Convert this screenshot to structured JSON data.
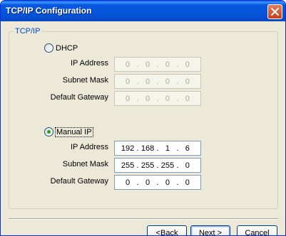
{
  "window": {
    "title": "TCP/IP Configuration"
  },
  "group": {
    "label": "TCP/IP"
  },
  "dhcp": {
    "label": "DHCP",
    "selected": false,
    "fields": [
      {
        "label": "IP Address",
        "segments": [
          "0",
          "0",
          "0",
          "0"
        ]
      },
      {
        "label": "Subnet Mask",
        "segments": [
          "0",
          "0",
          "0",
          "0"
        ]
      },
      {
        "label": "Default Gateway",
        "segments": [
          "0",
          "0",
          "0",
          "0"
        ]
      }
    ]
  },
  "manual": {
    "label": "Manual IP",
    "selected": true,
    "fields": [
      {
        "label": "IP Address",
        "segments": [
          "192",
          "168",
          "1",
          "6"
        ]
      },
      {
        "label": "Subnet Mask",
        "segments": [
          "255",
          "255",
          "255",
          "0"
        ]
      },
      {
        "label": "Default Gateway",
        "segments": [
          "0",
          "0",
          "0",
          "0"
        ]
      }
    ]
  },
  "buttons": {
    "back": {
      "label_pre": "< ",
      "label_accel": "B",
      "label_rest": "ack"
    },
    "next": {
      "label_accel": "N",
      "label_rest": "ext >"
    },
    "cancel": {
      "label": "Cancel"
    }
  },
  "colors": {
    "titlebar": "#0453d7",
    "group_label": "#0046d5",
    "dialog_bg": "#ece9d8"
  }
}
